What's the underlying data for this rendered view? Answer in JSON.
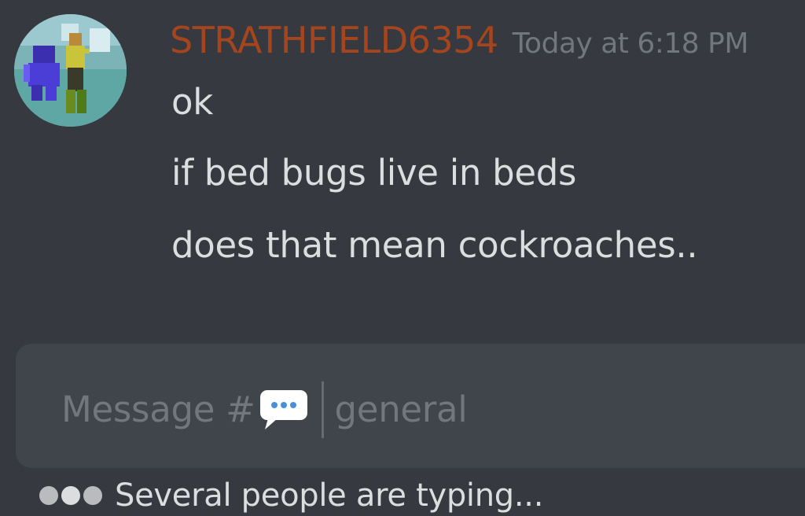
{
  "message": {
    "author": "STRATHFIELD6354",
    "timestamp": "Today at 6:18 PM",
    "lines": [
      "ok",
      "if bed bugs live in beds",
      "does that mean cockroaches.."
    ],
    "author_color": "#a4451d"
  },
  "composer": {
    "placeholder_prefix": "Message #",
    "placeholder_channel": "general",
    "icon": "speech-bubble-icon"
  },
  "typing_indicator": {
    "text": "Several people are typing..."
  },
  "colors": {
    "background": "#36393f",
    "composer_bg": "#40444b",
    "text": "#dcddde",
    "muted": "#72767d"
  }
}
